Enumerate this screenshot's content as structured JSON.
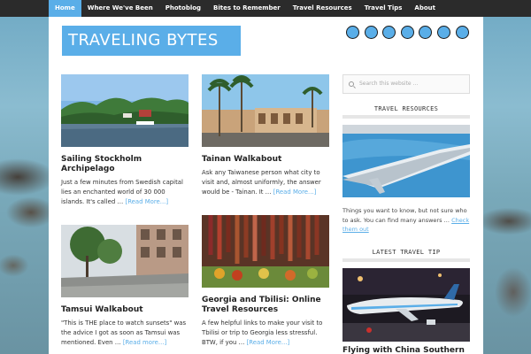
{
  "nav": {
    "items": [
      {
        "label": "Home",
        "active": true
      },
      {
        "label": "Where We've Been",
        "active": false
      },
      {
        "label": "Photoblog",
        "active": false
      },
      {
        "label": "Bites to Remember",
        "active": false
      },
      {
        "label": "Travel Resources",
        "active": false
      },
      {
        "label": "Travel Tips",
        "active": false
      },
      {
        "label": "About",
        "active": false
      }
    ]
  },
  "site": {
    "logo": "TRAVELING BYTES",
    "accent": "#5aaee8",
    "social_icons": [
      "social-icon-1",
      "social-icon-2",
      "social-icon-3",
      "social-icon-4",
      "social-icon-5",
      "social-icon-6",
      "social-icon-7"
    ]
  },
  "posts": [
    {
      "title": "Sailing Stockholm Archipelago",
      "excerpt": "Just a few minutes from Swedish capital lies an enchanted world of 30 000 islands. It's called …",
      "more": "[Read More...]"
    },
    {
      "title": "Tainan Walkabout",
      "excerpt": "Ask any Taiwanese person what city to visit and, almost uniformly, the answer would be - Tainan. It …",
      "more": "[Read More...]"
    },
    {
      "title": "Tamsui Walkabout",
      "excerpt": "\"This is THE place to watch sunsets\" was the advice I got as soon as Tamsui was mentioned. Even …",
      "more": "[Read more...]"
    },
    {
      "title": "Georgia and Tbilisi: Online Travel Resources",
      "excerpt": "A few helpful links to make your visit to Tbilisi or trip to Georgia less stressful. BTW, if you …",
      "more": "[Read More...]"
    }
  ],
  "sidebar": {
    "search_placeholder": "Search this website ...",
    "resources_title": "TRAVEL RESOURCES",
    "resources_text": "Things you want to know, but not sure who to ask. You can find many answers … ",
    "resources_link": "Check them out",
    "tip_title": "LATEST TRAVEL TIP",
    "tip_post_title": "Flying with China Southern"
  }
}
